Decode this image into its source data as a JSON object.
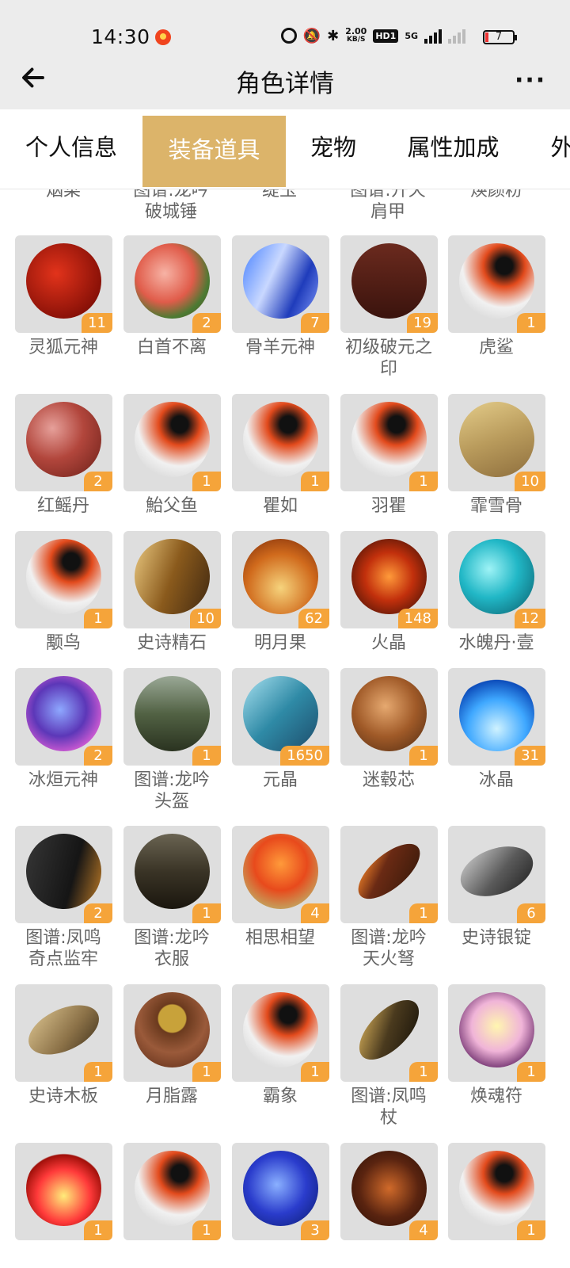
{
  "status": {
    "time": "14:30",
    "speed_top": "2.00",
    "speed_bottom": "KB/S",
    "hd": "HD1",
    "net": "5G",
    "battery": "7"
  },
  "header": {
    "title": "角色详情",
    "more": "···"
  },
  "tabs": [
    {
      "label": "个人信息",
      "active": false
    },
    {
      "label": "装备道具",
      "active": true
    },
    {
      "label": "宠物",
      "active": false
    },
    {
      "label": "属性加成",
      "active": false
    },
    {
      "label": "外",
      "active": false
    }
  ],
  "partial_row": [
    {
      "label": "烟菜"
    },
    {
      "label": "图谱:龙吟\n破城锤"
    },
    {
      "label": "缇玉"
    },
    {
      "label": "图谱:开天\n肩甲"
    },
    {
      "label": "焕颜粉"
    }
  ],
  "items": [
    {
      "name": "灵狐元神",
      "count": "11",
      "art": "a-red"
    },
    {
      "name": "白首不离",
      "count": "2",
      "art": "a-flowers"
    },
    {
      "name": "骨羊元神",
      "count": "7",
      "art": "a-blue"
    },
    {
      "name": "初级破元之\n印",
      "count": "19",
      "art": "a-box"
    },
    {
      "name": "虎鲨",
      "count": "1",
      "art": "a-koi"
    },
    {
      "name": "红鳐丹",
      "count": "2",
      "art": "a-pearl"
    },
    {
      "name": "鮐父鱼",
      "count": "1",
      "art": "a-koi"
    },
    {
      "name": "瞿如",
      "count": "1",
      "art": "a-koi"
    },
    {
      "name": "羽瞿",
      "count": "1",
      "art": "a-koi"
    },
    {
      "name": "霏雪骨",
      "count": "10",
      "art": "a-horn"
    },
    {
      "name": "颙鸟",
      "count": "1",
      "art": "a-koi"
    },
    {
      "name": "史诗精石",
      "count": "10",
      "art": "a-gold"
    },
    {
      "name": "明月果",
      "count": "62",
      "art": "a-fruit"
    },
    {
      "name": "火晶",
      "count": "148",
      "art": "a-fire"
    },
    {
      "name": "水魄丹·壹",
      "count": "12",
      "art": "a-teal"
    },
    {
      "name": "冰烜元神",
      "count": "2",
      "art": "a-purple"
    },
    {
      "name": "图谱:龙吟\n头盔",
      "count": "1",
      "art": "a-helm"
    },
    {
      "name": "元晶",
      "count": "1650",
      "art": "a-leaf"
    },
    {
      "name": "迷毂芯",
      "count": "1",
      "art": "a-root"
    },
    {
      "name": "冰晶",
      "count": "31",
      "art": "a-iceflame"
    },
    {
      "name": "图谱:凤鸣\n奇点监牢",
      "count": "2",
      "art": "a-scroll"
    },
    {
      "name": "图谱:龙吟\n衣服",
      "count": "1",
      "art": "a-armor"
    },
    {
      "name": "相思相望",
      "count": "4",
      "art": "a-bouquet"
    },
    {
      "name": "图谱:龙吟\n天火弩",
      "count": "1",
      "art": "a-gun"
    },
    {
      "name": "史诗银锭",
      "count": "6",
      "art": "a-silver"
    },
    {
      "name": "史诗木板",
      "count": "1",
      "art": "a-board"
    },
    {
      "name": "月脂露",
      "count": "1",
      "art": "a-bowl"
    },
    {
      "name": "霸象",
      "count": "1",
      "art": "a-koi"
    },
    {
      "name": "图谱:凤鸣\n杖",
      "count": "1",
      "art": "a-staff"
    },
    {
      "name": "焕魂符",
      "count": "1",
      "art": "a-crystal"
    },
    {
      "name": "",
      "count": "1",
      "art": "a-flame"
    },
    {
      "name": "",
      "count": "1",
      "art": "a-koi"
    },
    {
      "name": "",
      "count": "3",
      "art": "a-bluejade"
    },
    {
      "name": "",
      "count": "4",
      "art": "a-rock"
    },
    {
      "name": "",
      "count": "1",
      "art": "a-koi"
    }
  ]
}
